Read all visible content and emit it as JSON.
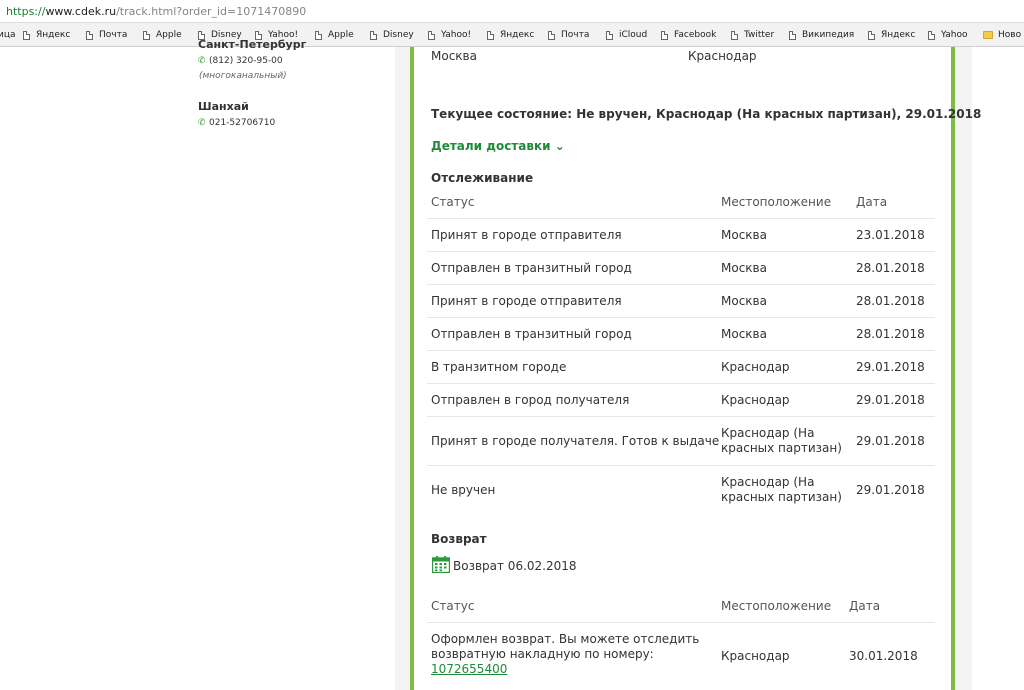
{
  "browser": {
    "url_scheme": "https://",
    "url_host": "www.cdek.ru",
    "url_path": "/track.html?order_id=1071470890",
    "bookmarks": [
      {
        "label": "ица",
        "icon": "none"
      },
      {
        "label": "Яндекс",
        "icon": "page-icon"
      },
      {
        "label": "Почта",
        "icon": "page-icon"
      },
      {
        "label": "Apple",
        "icon": "page-icon"
      },
      {
        "label": "Disney",
        "icon": "page-icon"
      },
      {
        "label": "Yahoo!",
        "icon": "page-icon"
      },
      {
        "label": "Apple",
        "icon": "page-icon"
      },
      {
        "label": "Disney",
        "icon": "page-icon"
      },
      {
        "label": "Yahoo!",
        "icon": "page-icon"
      },
      {
        "label": "Яндекс",
        "icon": "page-icon"
      },
      {
        "label": "Почта",
        "icon": "page-icon"
      },
      {
        "label": "iCloud",
        "icon": "page-icon"
      },
      {
        "label": "Facebook",
        "icon": "page-icon"
      },
      {
        "label": "Twitter",
        "icon": "page-icon"
      },
      {
        "label": "Википедия",
        "icon": "page-icon"
      },
      {
        "label": "Яндекс",
        "icon": "page-icon"
      },
      {
        "label": "Yahoo",
        "icon": "page-icon"
      },
      {
        "label": "Ново",
        "icon": "folder-icon"
      }
    ]
  },
  "offices": [
    {
      "city": "Санкт-Петербург",
      "phone": "(812) 320-95-00",
      "note": "(многоканальный)"
    },
    {
      "city": "Шанхай",
      "phone": "021-52706710",
      "note": ""
    }
  ],
  "shipment": {
    "from_city": "Москва",
    "to_city": "Краснодар",
    "current_state": "Текущее состояние: Не вручен, Краснодар (На красных партизан), 29.01.2018",
    "details_link": "Детали доставки",
    "details_chevron": "⌄"
  },
  "tracking": {
    "title": "Отслеживание",
    "headers": {
      "status": "Статус",
      "location": "Местоположение",
      "date": "Дата"
    },
    "rows": [
      {
        "status": "Принят в городе отправителя",
        "location": "Москва",
        "date": "23.01.2018"
      },
      {
        "status": "Отправлен в транзитный город",
        "location": "Москва",
        "date": "28.01.2018"
      },
      {
        "status": "Принят в городе отправителя",
        "location": "Москва",
        "date": "28.01.2018"
      },
      {
        "status": "Отправлен в транзитный город",
        "location": "Москва",
        "date": "28.01.2018"
      },
      {
        "status": "В транзитном городе",
        "location": "Краснодар",
        "date": "29.01.2018"
      },
      {
        "status": "Отправлен в город получателя",
        "location": "Краснодар",
        "date": "29.01.2018"
      },
      {
        "status": "Принят в городе получателя. Готов к выдаче",
        "location": "Краснодар (На красных партизан)",
        "date": "29.01.2018"
      },
      {
        "status": "Не вручен",
        "location": "Краснодар (На красных партизан)",
        "date": "29.01.2018"
      }
    ]
  },
  "return_section": {
    "title": "Возврат",
    "return_date_text": "Возврат 06.02.2018",
    "calendar_icon": "calendar-icon",
    "headers": {
      "status": "Статус",
      "location": "Местоположение",
      "date": "Дата"
    },
    "row": {
      "status": "Оформлен возврат. Вы можете отследить возвратную накладную по номеру:",
      "link": "1072655400",
      "location": "Краснодар",
      "date": "30.01.2018"
    }
  },
  "colors": {
    "accent_green": "#7cbd42",
    "link_green": "#1f8a3a"
  }
}
